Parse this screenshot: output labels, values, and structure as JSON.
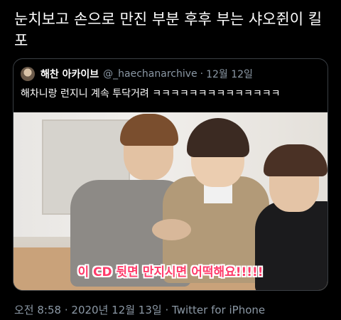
{
  "tweet": {
    "text": "눈치보고 손으로 만진 부분 후후 부는 샤오쥔이 킬포"
  },
  "quoted": {
    "name": "해찬 아카이브",
    "handle": "@_haechanarchive",
    "separator": "·",
    "time": "12월 12일",
    "text": "해차니랑 런지니 계속 투닥거려 ㅋㅋㅋㅋㅋㅋㅋㅋㅋㅋㅋㅋㅋㅋ",
    "media_caption": "이 CD 뒷면 만지시면 어떡해요!!!!!"
  },
  "meta": {
    "time": "오전 8:58",
    "separator1": "·",
    "date": "2020년 12월 13일",
    "separator2": "·",
    "source": "Twitter for iPhone"
  },
  "colors": {
    "background": "#000000",
    "secondary_text": "#8b98a5",
    "border": "#3a3f44",
    "caption": "#ff3b6a"
  }
}
